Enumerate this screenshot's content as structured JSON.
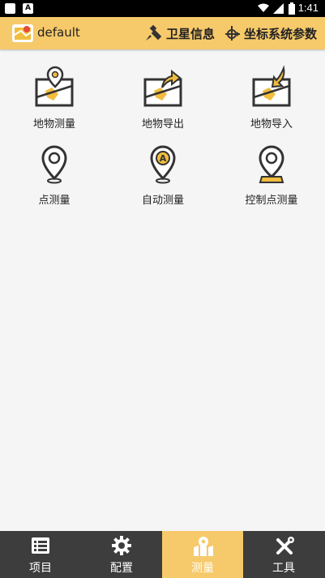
{
  "status_bar": {
    "time": "1:41"
  },
  "app_bar": {
    "title": "default",
    "actions": [
      {
        "label": "卫星信息",
        "icon": "satellite-icon"
      },
      {
        "label": "坐标系统参数",
        "icon": "coordinate-axis-icon"
      }
    ]
  },
  "menu": {
    "items": [
      {
        "label": "地物测量",
        "icon": "map-pin-icon"
      },
      {
        "label": "地物导出",
        "icon": "map-export-icon"
      },
      {
        "label": "地物导入",
        "icon": "map-import-icon"
      },
      {
        "label": "点测量",
        "icon": "location-pin-icon"
      },
      {
        "label": "自动测量",
        "icon": "auto-pin-icon"
      },
      {
        "label": "控制点测量",
        "icon": "control-point-pin-icon"
      }
    ]
  },
  "tabs": [
    {
      "label": "项目",
      "icon": "list-icon"
    },
    {
      "label": "配置",
      "icon": "gear-icon"
    },
    {
      "label": "测量",
      "icon": "map-pin-icon",
      "active": true
    },
    {
      "label": "工具",
      "icon": "tools-icon"
    }
  ],
  "colors": {
    "accent": "#f6c96a",
    "tabbar": "#3d3d3d",
    "icon_yellow": "#f1bd3e"
  }
}
